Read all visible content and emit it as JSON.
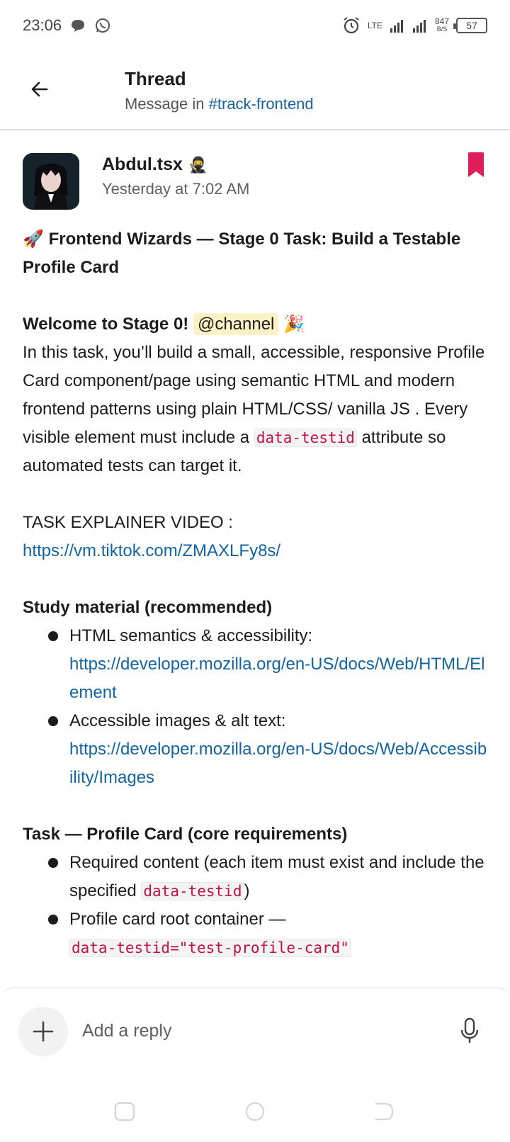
{
  "status_bar": {
    "time": "23:06",
    "net_speed_value": "847",
    "net_speed_unit": "B/S",
    "network_type": "LTE",
    "battery": "57"
  },
  "header": {
    "title": "Thread",
    "subtitle_prefix": "Message in",
    "channel": "#track-frontend"
  },
  "message": {
    "author": "Abdul.tsx",
    "author_emoji": "🥷",
    "timestamp": "Yesterday at 7:02 AM",
    "title_emoji": "🚀",
    "title": "Frontend Wizards — Stage 0 Task: Build a Testable Profile Card",
    "welcome": "Welcome to Stage 0!",
    "mention": "@channel",
    "welcome_emoji": "🎉",
    "intro": " In this task, you’ll build a small, accessible, responsive Profile Card component/page using semantic HTML and modern frontend patterns using plain HTML/CSS/ vanilla JS . Every visible element must include a ",
    "intro_code": "data-testid",
    "intro_end": " attribute so automated tests can target it.",
    "video_label": "TASK EXPLAINER VIDEO",
    "video_colon": " :",
    "video_link": "https://vm.tiktok.com/ZMAXLFy8s/",
    "study_heading": "Study material (recommended)",
    "study_items": [
      {
        "label": "HTML semantics & accessibility:",
        "link": "https://developer.mozilla.org/en-US/docs/Web/HTML/Element"
      },
      {
        "label": "Accessible images & alt text:",
        "link": "https://developer.mozilla.org/en-US/docs/Web/Accessibility/Images"
      }
    ],
    "task_heading": "Task — Profile Card (core requirements)",
    "task_items": [
      {
        "text": "Required content (each item must exist and include the specified ",
        "code": "data-testid",
        "end": ")"
      },
      {
        "text": "Profile card root container — ",
        "code": "data-testid=\"test-profile-card\"",
        "end": ""
      }
    ]
  },
  "composer": {
    "placeholder": "Add a reply"
  },
  "colors": {
    "link": "#1264a3",
    "code_text": "#c01343",
    "mention_bg": "#fdf2c6",
    "bookmark": "#e01e5a"
  },
  "icons": [
    "chat-bubble-icon",
    "whatsapp-icon",
    "alarm-icon",
    "signal-icon",
    "battery-icon",
    "back-arrow-icon",
    "bookmark-icon",
    "plus-icon",
    "microphone-icon",
    "nav-recents-icon",
    "nav-home-icon",
    "nav-back-icon"
  ]
}
